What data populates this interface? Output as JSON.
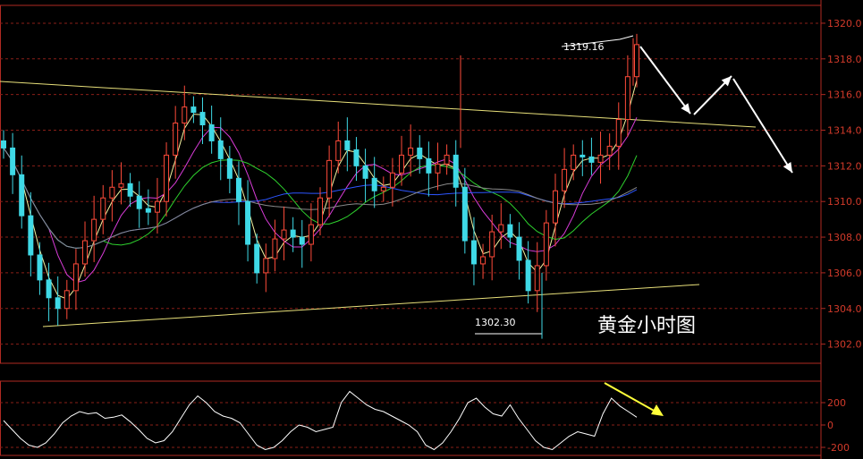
{
  "chart_data": [
    {
      "type": "candlestick",
      "title": "黄金小时图",
      "ylim": [
        1301,
        1321
      ],
      "y_ticks": [
        "1302.0",
        "1304.0",
        "1306.0",
        "1308.0",
        "1310.0",
        "1312.0",
        "1314.0",
        "1316.0",
        "1318.0",
        "1320.0"
      ],
      "grid": true,
      "annotations": [
        {
          "label": "1319.16",
          "value": 1319.16
        },
        {
          "label": "1302.30",
          "value": 1302.3
        }
      ],
      "close": [
        1313.0,
        1311.5,
        1309.2,
        1307.0,
        1305.6,
        1304.6,
        1304.0,
        1305.0,
        1306.5,
        1307.8,
        1309.0,
        1310.2,
        1310.8,
        1311.0,
        1310.3,
        1309.6,
        1309.4,
        1310.0,
        1312.6,
        1314.4,
        1315.3,
        1315.0,
        1314.3,
        1313.4,
        1312.4,
        1311.3,
        1310.0,
        1307.6,
        1306.0,
        1306.8,
        1307.9,
        1308.4,
        1308.0,
        1307.6,
        1308.7,
        1310.2,
        1312.3,
        1313.4,
        1312.9,
        1312.0,
        1311.3,
        1310.6,
        1310.8,
        1311.6,
        1312.6,
        1313.0,
        1312.4,
        1311.6,
        1312.1,
        1312.6,
        1310.8,
        1307.8,
        1306.5,
        1306.9,
        1308.3,
        1308.7,
        1308.0,
        1306.7,
        1305.0,
        1306.4,
        1308.8,
        1310.6,
        1311.8,
        1312.6,
        1312.5,
        1312.2,
        1312.6,
        1313.1,
        1314.6,
        1317.0,
        1318.8
      ],
      "indicator_panel": {
        "y_ticks": [
          "200",
          "0",
          "-200"
        ],
        "ylim": [
          -280,
          300
        ],
        "values": [
          40,
          -40,
          -120,
          -180,
          -200,
          -160,
          -80,
          20,
          80,
          120,
          100,
          110,
          60,
          70,
          90,
          30,
          -40,
          -120,
          -160,
          -140,
          -60,
          60,
          180,
          260,
          200,
          120,
          80,
          60,
          20,
          -80,
          -180,
          -220,
          -200,
          -140,
          -60,
          0,
          -20,
          -60,
          -40,
          -20,
          200,
          300,
          240,
          180,
          140,
          120,
          80,
          40,
          0,
          -60,
          -180,
          -220,
          -160,
          -60,
          60,
          200,
          240,
          160,
          100,
          80,
          180,
          60,
          -40,
          -140,
          -200,
          -220,
          -160,
          -100,
          -60,
          -80,
          -100,
          100,
          240,
          170,
          120,
          70
        ]
      }
    }
  ]
}
